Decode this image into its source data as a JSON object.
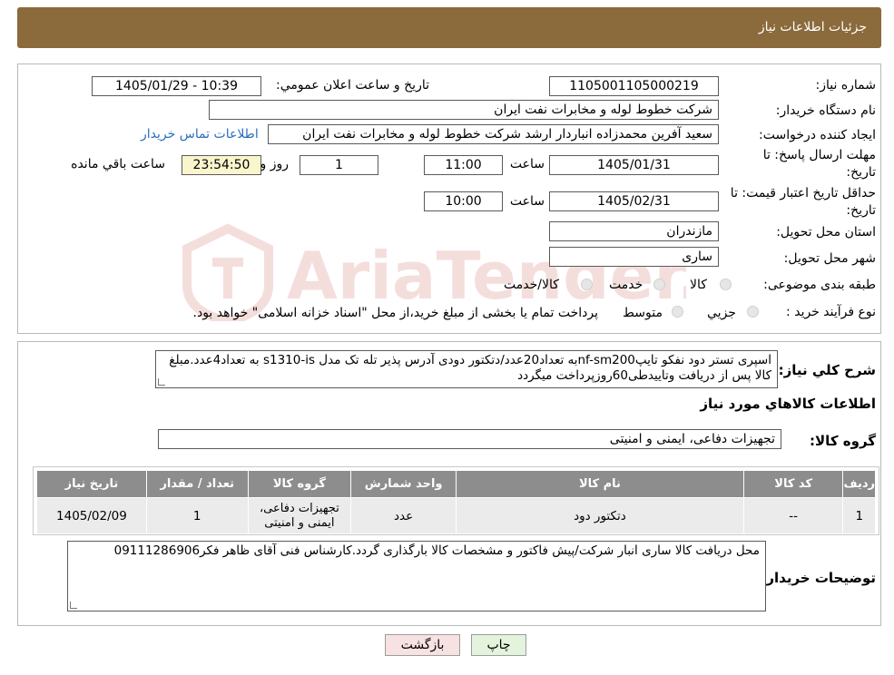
{
  "header": {
    "title": "جزئیات اطلاعات نیاز"
  },
  "watermark": {
    "text": "AriaTender.neT",
    "color": "#c0392b"
  },
  "form": {
    "need_number": {
      "label": "شماره نیاز:",
      "value": "1105001105000219"
    },
    "announce_datetime": {
      "label": "تاریخ و ساعت اعلان عمومي:",
      "value": "1405/01/29 - 10:39"
    },
    "buyer_org": {
      "label": "نام دستگاه خريدار:",
      "value": "شرکت خطوط لوله و مخابرات نفت ایران"
    },
    "requester": {
      "label": "ایجاد کننده درخواست:",
      "value": "سعید آفرین محمدزاده انباردار ارشد شرکت خطوط لوله و مخابرات نفت ایران",
      "contact_link": "اطلاعات تماس خریدار"
    },
    "reply_deadline": {
      "label_line1": "مهلت ارسال پاسخ: تا",
      "label_line2": "تاریخ:",
      "date": "1405/01/31",
      "time_label": "ساعت",
      "time": "11:00",
      "days": "1",
      "days_label": "روز و",
      "remaining": "23:54:50",
      "remaining_label": "ساعت باقي مانده"
    },
    "price_validity": {
      "label_line1": "حداقل تاریخ اعتبار قیمت: تا",
      "label_line2": "تاریخ:",
      "date": "1405/02/31",
      "time_label": "ساعت",
      "time": "10:00"
    },
    "province": {
      "label": "استان محل تحویل:",
      "value": "مازندران"
    },
    "city": {
      "label": "شهر محل تحویل:",
      "value": "ساری"
    },
    "category": {
      "label": "طبقه بندی موضوعی:",
      "options": [
        "کالا",
        "خدمت",
        "کالا/خدمت"
      ]
    },
    "purchase_process": {
      "label": "نوع فرآیند خرید :",
      "options": [
        "جزیي",
        "متوسط"
      ],
      "note": "پرداخت تمام یا بخشی از مبلغ خرید،از محل \"اسناد خزانه اسلامی\" خواهد بود."
    }
  },
  "details": {
    "description_label": "شرح کلي نیاز:",
    "description": "اسپری تستر دود نفکو تایپnf-sm200به تعداد20عدد/دتکتور دودی آدرس پذیر تله تک مدل s1310-is به تعداد4عدد.مبلغ کالا پس از دریافت وتاییدطی60روزپرداخت میگردد",
    "items_heading": "اطلاعات کالاهاي مورد نیاز",
    "goods_group_label": "گروه کالا:",
    "goods_group": "تجهیزات دفاعی، ایمنی و امنیتی",
    "table": {
      "headers": [
        "ردیف",
        "کد کالا",
        "نام کالا",
        "واحد شمارش",
        "گروه کالا",
        "تعداد / مقدار",
        "تاریخ نیاز"
      ],
      "rows": [
        [
          "1",
          "--",
          "دتکتور دود",
          "عدد",
          "تجهیزات دفاعی، ایمنی و امنیتی",
          "1",
          "1405/02/09"
        ]
      ]
    },
    "buyer_notes_label": "توضیحات خریدار:",
    "buyer_notes": "محل دریافت کالا ساری انبار شرکت/پیش فاکتور و مشخصات کالا بارگذاری گردد.کارشناس فنی آقای ظاهر فکر09111286906"
  },
  "buttons": {
    "print": "چاپ",
    "back": "بازگشت"
  }
}
